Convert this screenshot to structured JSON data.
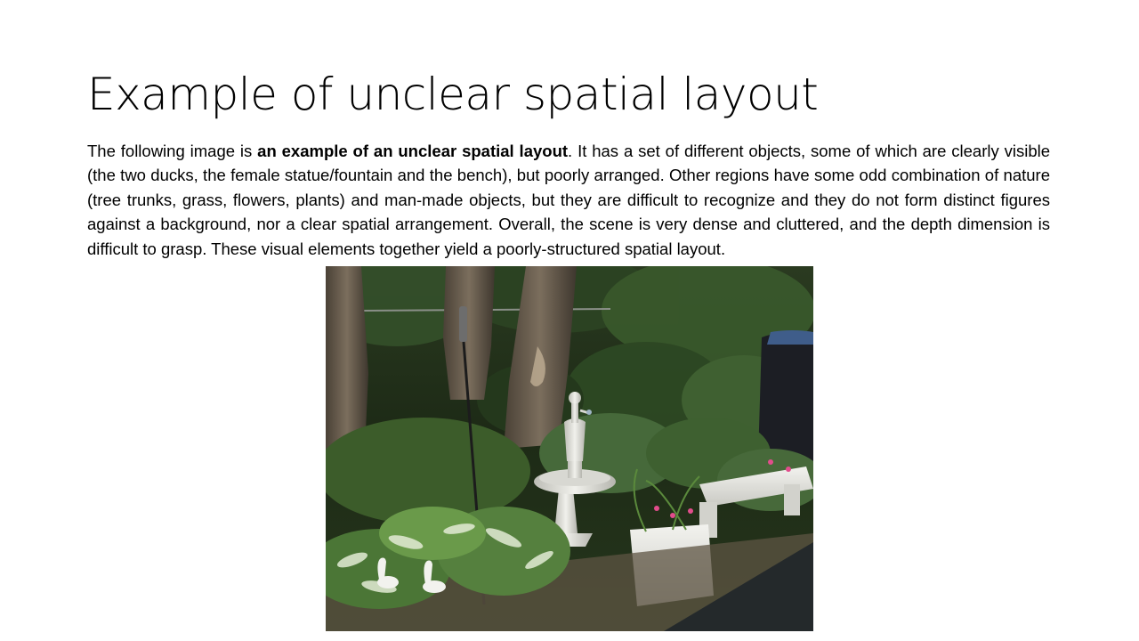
{
  "slide": {
    "title": "Example of unclear spatial layout",
    "body": {
      "intro": "The following image is ",
      "emphasis": "an example of an unclear spatial layout",
      "rest": ". It has a set of different objects, some of which are clearly visible (the two ducks, the female statue/fountain and the bench), but poorly arranged. Other regions have some odd combination of nature (tree trunks, grass, flowers, plants) and man-made objects, but they are difficult to recognize and they do not form distinct figures against a background, nor a clear spatial arrangement. Overall, the scene is very dense and cluttered, and the depth dimension is difficult to grasp. These visual elements together yield a poorly-structured spatial layout."
    }
  },
  "colors": {
    "background": "#ffffff",
    "text": "#000000",
    "foliage_dark": "#1c2616",
    "foliage_mid": "#3b5a2a",
    "statue": "#e6e6e2",
    "bark": "#6e6253"
  }
}
